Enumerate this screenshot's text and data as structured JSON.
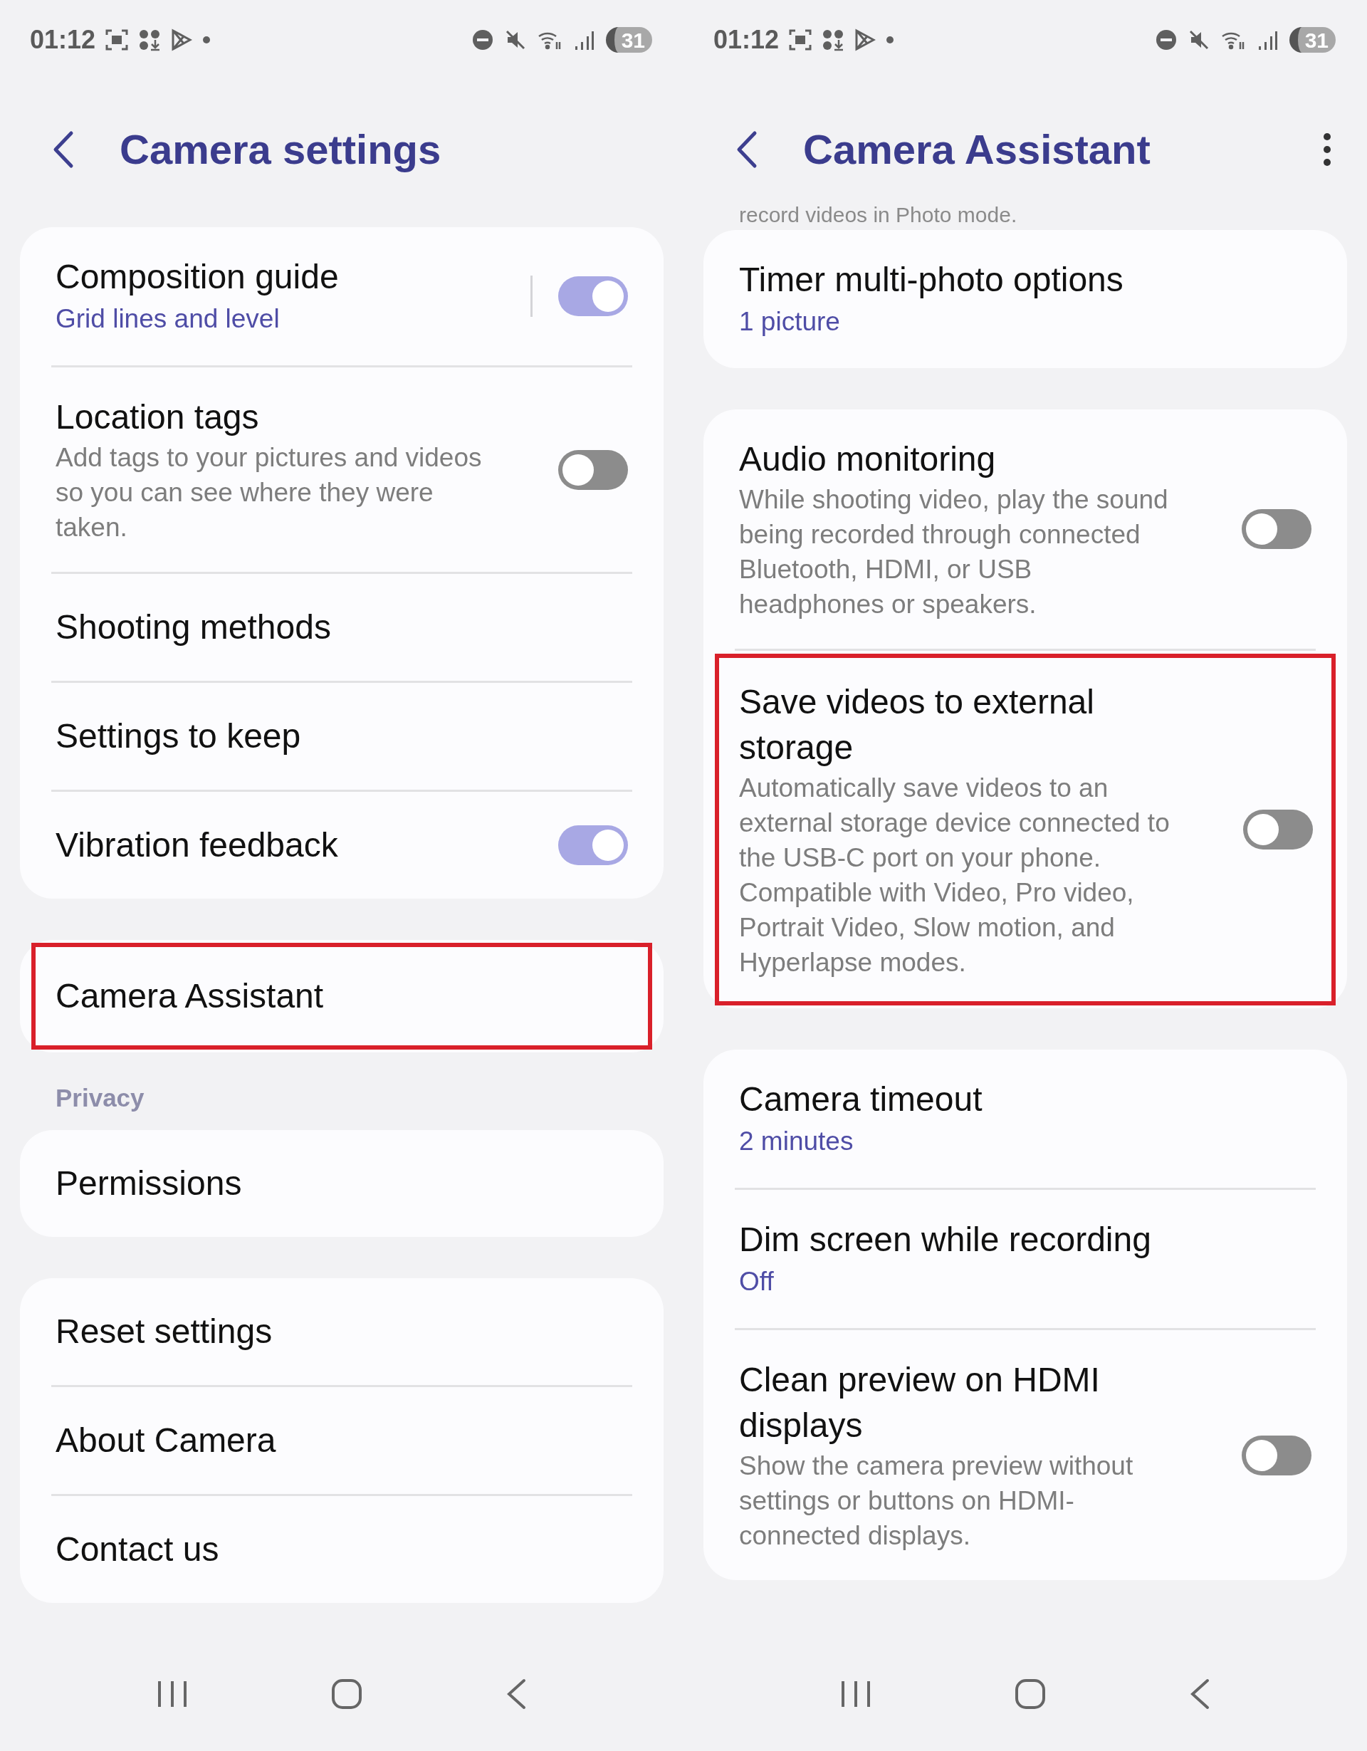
{
  "panels": [
    {
      "status_bar": {
        "time": "01:12",
        "battery": "31"
      },
      "header": {
        "title": "Camera settings"
      },
      "sections": [
        {
          "rows": [
            {
              "kind": "value",
              "title": "Composition guide",
              "subtitle": "Grid lines and level",
              "toggle": true,
              "split": true,
              "highlighted": false
            },
            {
              "kind": "description",
              "title": "Location tags",
              "subtitle": "Add tags to your pictures and videos so you can see where they were taken.",
              "toggle": false,
              "highlighted": false
            },
            {
              "kind": "plain",
              "title": "Shooting methods",
              "highlighted": false
            },
            {
              "kind": "plain",
              "title": "Settings to keep",
              "highlighted": false
            },
            {
              "kind": "plain",
              "title": "Vibration feedback",
              "toggle": true,
              "highlighted": false
            }
          ]
        },
        {
          "rows": [
            {
              "kind": "plain",
              "title": "Camera Assistant",
              "highlighted": true
            }
          ]
        },
        {
          "label": "Privacy",
          "rows": [
            {
              "kind": "plain",
              "title": "Permissions",
              "highlighted": false
            }
          ]
        },
        {
          "rows": [
            {
              "kind": "plain",
              "title": "Reset settings",
              "highlighted": false
            },
            {
              "kind": "plain",
              "title": "About Camera",
              "highlighted": false
            },
            {
              "kind": "plain",
              "title": "Contact us",
              "highlighted": false
            }
          ]
        }
      ]
    },
    {
      "status_bar": {
        "time": "01:12",
        "battery": "31"
      },
      "header": {
        "title": "Camera Assistant",
        "more_menu": true
      },
      "top_note": "record videos in Photo mode.",
      "sections": [
        {
          "rows": [
            {
              "kind": "value",
              "title": "Timer multi-photo options",
              "subtitle": "1 picture",
              "highlighted": false
            }
          ]
        },
        {
          "rows": [
            {
              "kind": "description",
              "title": "Audio monitoring",
              "subtitle": "While shooting video, play the sound being recorded through connected Bluetooth, HDMI, or USB headphones or speakers.",
              "toggle": false,
              "highlighted": false
            },
            {
              "kind": "description",
              "title": "Save videos to external storage",
              "subtitle": "Automatically save videos to an external storage device connected to the USB-C port on your phone. Compatible with Video, Pro video, Portrait Video, Slow motion, and Hyperlapse modes.",
              "toggle": false,
              "highlighted": true
            }
          ]
        },
        {
          "rows": [
            {
              "kind": "value",
              "title": "Camera timeout",
              "subtitle": "2 minutes",
              "highlighted": false
            },
            {
              "kind": "value",
              "title": "Dim screen while recording",
              "subtitle": "Off",
              "highlighted": false
            },
            {
              "kind": "description",
              "title": "Clean preview on HDMI displays",
              "subtitle": "Show the camera preview without settings or buttons on HDMI-connected displays.",
              "toggle": false,
              "highlighted": false
            }
          ]
        }
      ]
    }
  ]
}
